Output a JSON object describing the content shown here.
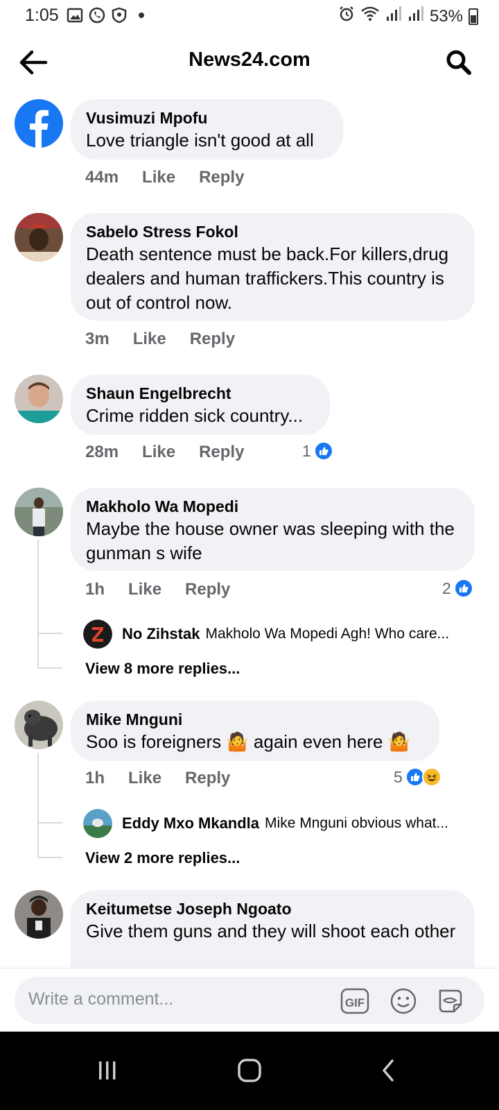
{
  "status_bar": {
    "time": "1:05",
    "battery": "53%"
  },
  "header": {
    "title": "News24.com"
  },
  "comments": [
    {
      "author": "Vusimuzi Mpofu",
      "text": "Love triangle isn't good at all",
      "time": "44m",
      "like": "Like",
      "reply": "Reply"
    },
    {
      "author": "Sabelo Stress Fokol",
      "text": "Death sentence must be back.For killers,drug dealers and human traffickers.This country is out of control now.",
      "time": "3m",
      "like": "Like",
      "reply": "Reply"
    },
    {
      "author": "Shaun Engelbrecht",
      "text": "Crime ridden sick country...",
      "time": "28m",
      "like": "Like",
      "reply": "Reply",
      "reactions": "1"
    },
    {
      "author": "Makholo Wa Mopedi",
      "text": "Maybe the house owner was sleeping with the gunman s wife",
      "time": "1h",
      "like": "Like",
      "reply": "Reply",
      "reactions": "2",
      "reply_preview": {
        "author": "No Zihstak",
        "text": "Makholo Wa Mopedi Agh! Who care..."
      },
      "view_more": "View 8 more replies..."
    },
    {
      "author": "Mike Mnguni",
      "text": "Soo is foreigners 🤷 again even here 🤷",
      "time": "1h",
      "like": "Like",
      "reply": "Reply",
      "reactions": "5",
      "reply_preview": {
        "author": "Eddy Mxo Mkandla",
        "text": "Mike Mnguni obvious what..."
      },
      "view_more": "View 2 more replies..."
    },
    {
      "author": "Keitumetse Joseph Ngoato",
      "text": "Give them guns and they will shoot each other"
    }
  ],
  "compose": {
    "placeholder": "Write a comment...",
    "gif_label": "GIF"
  },
  "colors": {
    "facebook_blue": "#1877f2",
    "bubble_bg": "#f0f2f5",
    "meta_gray": "#65676b"
  }
}
